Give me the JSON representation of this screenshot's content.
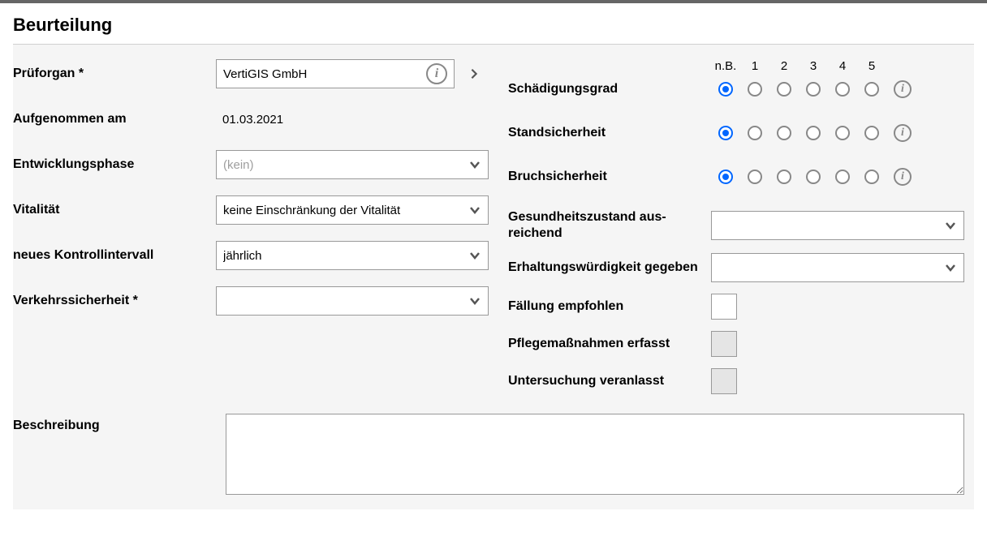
{
  "section_title": "Beurteilung",
  "left": {
    "prueforgan": {
      "label": "Prüforgan *",
      "value": "VertiGIS GmbH"
    },
    "aufgenommen": {
      "label": "Aufgenommen am",
      "value": "01.03.2021"
    },
    "entwicklung": {
      "label": "Entwicklungsphase",
      "placeholder": "(kein)"
    },
    "vitalitaet": {
      "label": "Vitalität",
      "value": "keine Einschränkung der Vitalität"
    },
    "kontrollintervall": {
      "label": "neues Kontrollintervall",
      "value": "jährlich"
    },
    "verkehrssicherheit": {
      "label": "Verkehrssicherheit *",
      "value": ""
    }
  },
  "right": {
    "radio_headers": [
      "n.B.",
      "1",
      "2",
      "3",
      "4",
      "5"
    ],
    "radio_rows": [
      {
        "key": "schaedigungsgrad",
        "label": "Schädigungsgrad",
        "selected": 0
      },
      {
        "key": "standsicherheit",
        "label": "Standsicherheit",
        "selected": 0
      },
      {
        "key": "bruchsicherheit",
        "label": "Bruchsicherheit",
        "selected": 0
      }
    ],
    "gesundheit": {
      "label": "Gesundheitszustand aus­reichend",
      "value": ""
    },
    "erhaltung": {
      "label": "Erhaltungswürdigkeit gegeben",
      "value": ""
    },
    "faellung": {
      "label": "Fällung empfohlen",
      "checked": false,
      "disabled": false
    },
    "pflege": {
      "label": "Pflegemaßnahmen erfasst",
      "checked": false,
      "disabled": true
    },
    "untersuchung": {
      "label": "Untersuchung veranlasst",
      "checked": false,
      "disabled": true
    }
  },
  "beschreibung": {
    "label": "Beschreibung",
    "value": ""
  }
}
